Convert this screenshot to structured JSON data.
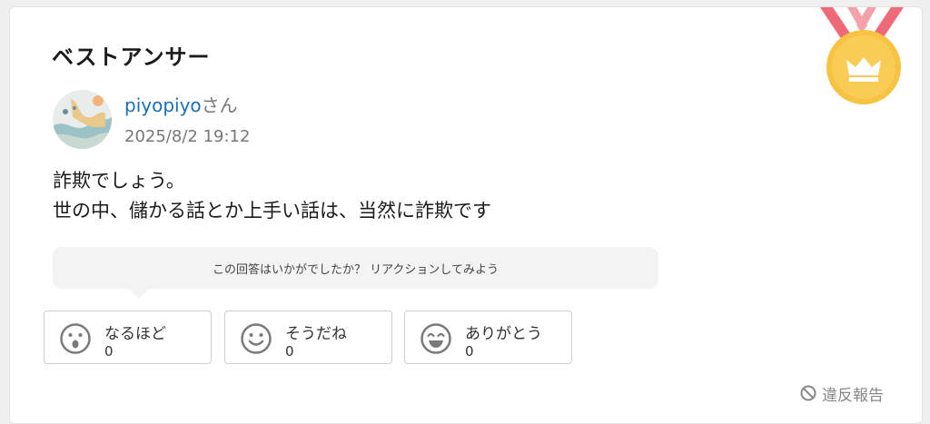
{
  "title": "ベストアンサー",
  "author": {
    "name": "piyopiyo",
    "suffix": "さん",
    "timestamp": "2025/8/2 19:12"
  },
  "answer": {
    "line1": "詐欺でしょう。",
    "line2": "世の中、儲かる話とか上手い話は、当然に詐欺です"
  },
  "reaction_prompt": "この回答はいかがでしたか？ リアクションしてみよう",
  "reactions": [
    {
      "label": "なるほど",
      "count": "0",
      "icon": "surprised-face-icon"
    },
    {
      "label": "そうだね",
      "count": "0",
      "icon": "smile-face-icon"
    },
    {
      "label": "ありがとう",
      "count": "0",
      "icon": "grin-face-icon"
    }
  ],
  "report_label": "違反報告",
  "colors": {
    "link": "#1a6fb5",
    "medal_gold": "#f6c342",
    "ribbon": "#ee6a78",
    "muted": "#777777"
  }
}
